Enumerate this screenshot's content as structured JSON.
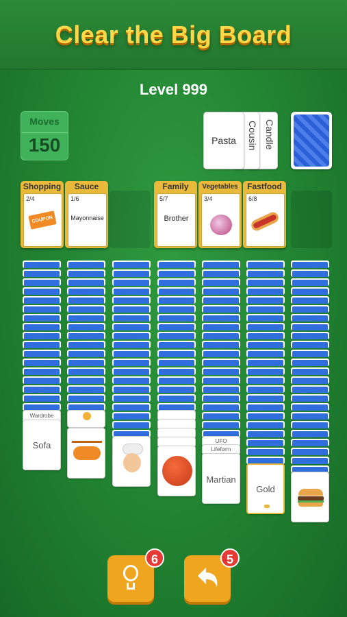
{
  "header": {
    "title": "Clear the Big Board",
    "level": "Level 999"
  },
  "moves": {
    "label": "Moves",
    "value": "150"
  },
  "waste": {
    "cards": [
      "Pasta",
      "Cousin",
      "Candle"
    ]
  },
  "foundations": [
    {
      "category": "Shopping",
      "count": "2/4",
      "card": ""
    },
    {
      "category": "Sauce",
      "count": "1/6",
      "card": "Mayonnaise"
    },
    {
      "category": "Family",
      "count": "5/7",
      "card": "Brother"
    },
    {
      "category": "Vegetables",
      "count": "3/4",
      "card": ""
    },
    {
      "category": "Fastfood",
      "count": "6/8",
      "card": ""
    }
  ],
  "tableau": {
    "col1": {
      "peek": "Wardrobe",
      "face": "Sofa"
    },
    "col5": {
      "peek1": "UFO",
      "peek2": "Lifeform",
      "face": "Martian"
    },
    "col6": {
      "face": "Gold"
    }
  },
  "coupon_text": "COUPON",
  "buttons": {
    "hint_badge": "6",
    "undo_badge": "5"
  },
  "colors": {
    "felt": "#1f7f2f",
    "title": "#ffd84a",
    "card_back": "#2f6edc",
    "gold": "#e8b93a",
    "button": "#f0a51f",
    "badge": "#e53935"
  }
}
